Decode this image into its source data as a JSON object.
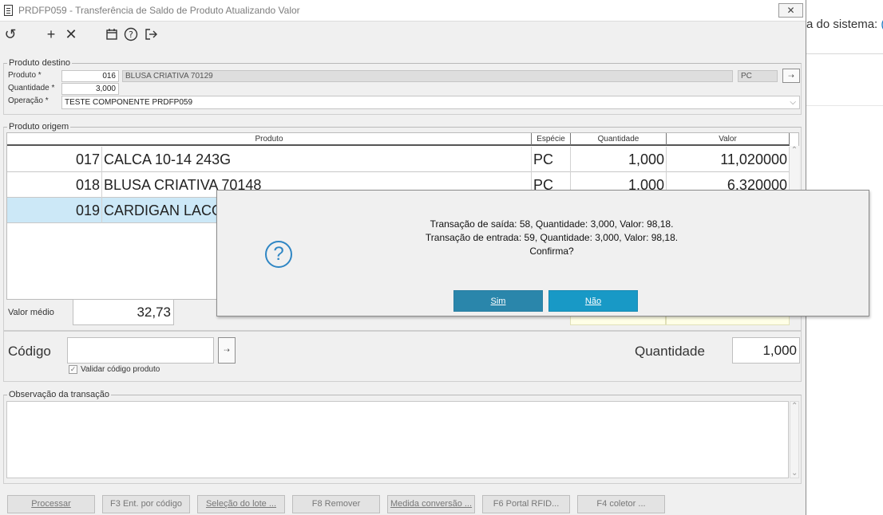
{
  "background_app": {
    "text": "a do sistema: ",
    "text_accent": "("
  },
  "window": {
    "title": "PRDFP059 - Transferência de Saldo de Produto Atualizando Valor",
    "close_glyph": "✕"
  },
  "toolbar": [
    {
      "name": "refresh-icon",
      "glyph": "↺"
    },
    {
      "name": "add-icon",
      "glyph": "+"
    },
    {
      "name": "delete-icon",
      "glyph": "✕"
    },
    {
      "name": "calendar-icon",
      "glyph": "▭"
    },
    {
      "name": "help-icon",
      "glyph": "?"
    },
    {
      "name": "exit-icon",
      "glyph": "⇥"
    }
  ],
  "produto_destino": {
    "legend": "Produto destino",
    "produto_label": "Produto *",
    "produto_code": "016",
    "produto_desc": "BLUSA CRIATIVA 70129",
    "unidade": "PC",
    "quantidade_label": "Quantidade *",
    "quantidade": "3,000",
    "operacao_label": "Operação *",
    "operacao": "TESTE COMPONENTE PRDFP059"
  },
  "produto_origem": {
    "legend": "Produto origem",
    "columns": [
      "Produto",
      "Espécie",
      "Quantidade",
      "Valor"
    ],
    "rows": [
      {
        "code": "017",
        "desc": "CALCA 10-14 243G",
        "especie": "PC",
        "quantidade": "1,000",
        "valor": "11,020000"
      },
      {
        "code": "018",
        "desc": "BLUSA CRIATIVA 70148",
        "especie": "PC",
        "quantidade": "1,000",
        "valor": "6,320000"
      },
      {
        "code": "019",
        "desc": "CARDIGAN LACO",
        "especie": "",
        "quantidade": "",
        "valor": ""
      }
    ],
    "valor_medio_label": "Valor médio",
    "valor_medio": "32,73"
  },
  "entrada": {
    "codigo_label": "Código",
    "codigo_value": "",
    "validar_label": "Validar código produto",
    "quantidade_label": "Quantidade",
    "quantidade": "1,000"
  },
  "observacao": {
    "legend": "Observação da transação",
    "value": ""
  },
  "action_buttons": [
    "Processar",
    "F3 Ent. por código",
    "Seleção do lote ...",
    "F8 Remover",
    "Medida conversão ...",
    "F6 Portal RFID...",
    "F4 coletor ..."
  ],
  "dialog": {
    "line1": "Transação de saída: 58, Quantidade: 3,000, Valor: 98,18.",
    "line2": "Transação de entrada: 59, Quantidade: 3,000, Valor: 98,18.",
    "line3": "Confirma?",
    "yes": "Sim",
    "no": "Não"
  },
  "colors": {
    "dialog_yes": "#2a86ab",
    "dialog_no": "#1899c6",
    "selection": "#cce8f7",
    "accent": "#2f86c4"
  }
}
